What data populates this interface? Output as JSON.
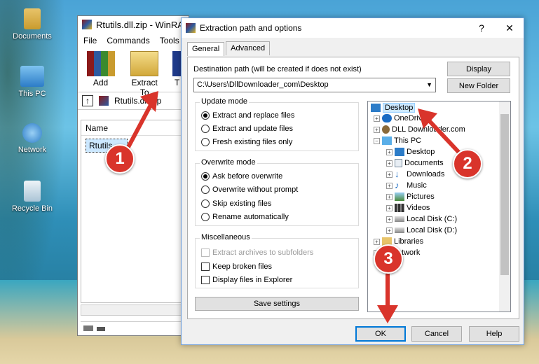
{
  "desktop": {
    "icons": [
      {
        "label": "Documents"
      },
      {
        "label": "This PC"
      },
      {
        "label": "Network"
      },
      {
        "label": "Recycle Bin"
      }
    ]
  },
  "winrar": {
    "title": "Rtutils.dll.zip - WinRA",
    "menu": [
      "File",
      "Commands",
      "Tools"
    ],
    "toolbar": {
      "add": "Add",
      "extract": "Extract To",
      "third": "T"
    },
    "address": "Rtutils.dll.zip",
    "list_header": "Name",
    "file": "Rtutils"
  },
  "dialog": {
    "title": "Extraction path and options",
    "help": "?",
    "close": "✕",
    "tabs": [
      "General",
      "Advanced"
    ],
    "dest_label": "Destination path (will be created if does not exist)",
    "dest_value": "C:\\Users\\DllDownloader_com\\Desktop",
    "display_btn": "Display",
    "new_folder_btn": "New Folder",
    "update_mode": {
      "title": "Update mode",
      "options": [
        "Extract and replace files",
        "Extract and update files",
        "Fresh existing files only"
      ]
    },
    "overwrite_mode": {
      "title": "Overwrite mode",
      "options": [
        "Ask before overwrite",
        "Overwrite without prompt",
        "Skip existing files",
        "Rename automatically"
      ]
    },
    "misc": {
      "title": "Miscellaneous",
      "options": [
        "Extract archives to subfolders",
        "Keep broken files",
        "Display files in Explorer"
      ]
    },
    "save_settings": "Save settings",
    "tree": [
      "Desktop",
      "OneDrive",
      "DLL Downloader.com",
      "This PC",
      "Desktop",
      "Documents",
      "Downloads",
      "Music",
      "Pictures",
      "Videos",
      "Local Disk (C:)",
      "Local Disk (D:)",
      "Libraries",
      "Network"
    ],
    "ok": "OK",
    "cancel": "Cancel",
    "help_btn": "Help"
  },
  "annotations": [
    "1",
    "2",
    "3"
  ],
  "colors": {
    "badge": "#d9342b",
    "selection": "#cce8ff",
    "accent": "#0078d7"
  }
}
